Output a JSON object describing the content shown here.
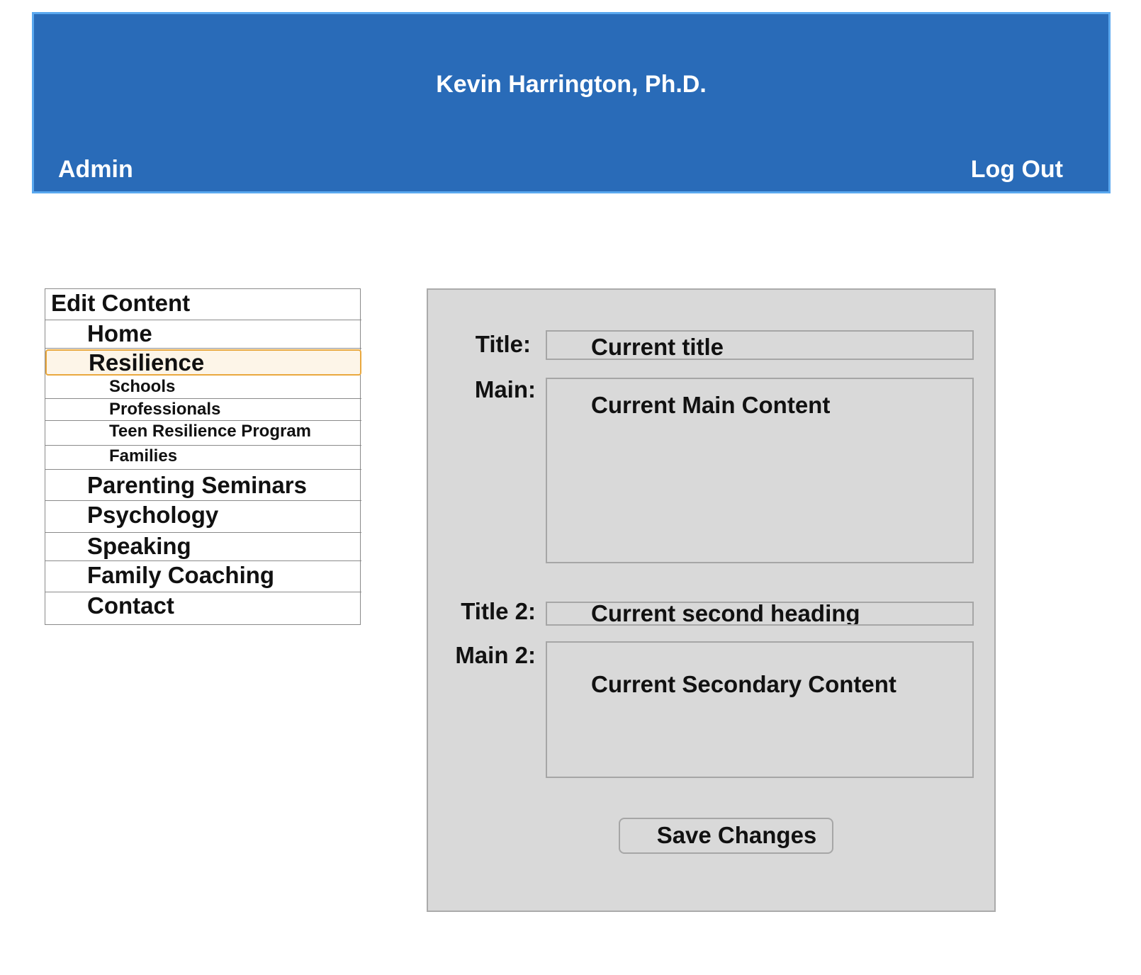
{
  "header": {
    "site_title": "Kevin Harrington, Ph.D.",
    "admin_label": "Admin",
    "logout_label": "Log Out",
    "background_color": "#296bb8",
    "border_color": "#5aa8ef"
  },
  "sidebar": {
    "heading": "Edit Content",
    "items": [
      {
        "label": "Home",
        "level": "top"
      },
      {
        "label": "Resilience",
        "level": "top",
        "selected": true
      },
      {
        "label": "Schools",
        "level": "sub"
      },
      {
        "label": "Professionals",
        "level": "sub"
      },
      {
        "label": "Teen Resilience Program",
        "level": "sub"
      },
      {
        "label": "Families",
        "level": "sub"
      },
      {
        "label": "Parenting Seminars",
        "level": "top"
      },
      {
        "label": "Psychology",
        "level": "top"
      },
      {
        "label": "Speaking",
        "level": "top"
      },
      {
        "label": "Family Coaching",
        "level": "top"
      },
      {
        "label": "Contact",
        "level": "top"
      }
    ],
    "selected_highlight_color": "#fdf5e8",
    "selected_border_color": "#e9a83e"
  },
  "editor": {
    "title_label": "Title:",
    "title_value": "Current title",
    "main_label": "Main:",
    "main_value": "Current Main Content",
    "title2_label": "Title 2:",
    "title2_value": "Current second heading",
    "main2_label": "Main 2:",
    "main2_value": "Current Secondary Content",
    "save_label": "Save Changes",
    "panel_color": "#d9d9d9"
  }
}
